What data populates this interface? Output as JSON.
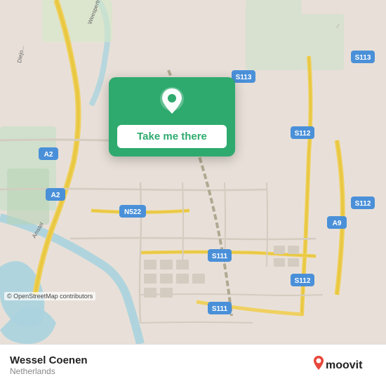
{
  "map": {
    "alt": "OpenStreetMap of Amsterdam area, Netherlands",
    "attribution": "© OpenStreetMap contributors"
  },
  "popup": {
    "button_label": "Take me there",
    "icon_name": "location-pin-icon"
  },
  "bottom_bar": {
    "location_name": "Wessel Coenen",
    "location_country": "Netherlands",
    "logo_text": "moovit",
    "logo_icon": "🔴"
  }
}
